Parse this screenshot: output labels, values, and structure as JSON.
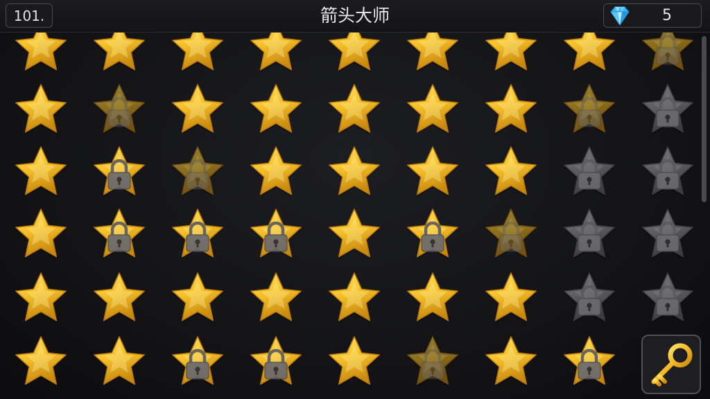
{
  "header": {
    "level_label": "101.",
    "title": "箭头大师",
    "gems": "5"
  },
  "icons": {
    "gem": "diamond-icon",
    "key": "key-icon",
    "lock": "padlock-icon",
    "star": "star-icon"
  },
  "colors": {
    "gold": "#F4C02A",
    "gold_light": "#FFE36A",
    "gold_dark": "#C98A10",
    "gray_star": "#5E5E62",
    "lock_gray": "#6A6A6E",
    "gem_blue": "#3FB8F5"
  },
  "grid": {
    "columns": 9,
    "rows": 6,
    "cells": [
      [
        "gold",
        "gold",
        "gold",
        "gold",
        "gold",
        "gold",
        "gold",
        "gold",
        "gold-locked-faded"
      ],
      [
        "gold",
        "gold-locked-faded",
        "gold",
        "gold",
        "gold",
        "gold",
        "gold",
        "gold-locked-faded",
        "gray-locked"
      ],
      [
        "gold",
        "gold-locked",
        "gold-locked-faded",
        "gold",
        "gold",
        "gold",
        "gold",
        "gray-locked",
        "gray-locked"
      ],
      [
        "gold",
        "gold-locked",
        "gold-locked",
        "gold-locked",
        "gold",
        "gold-locked",
        "gold-locked-faded",
        "gray-locked",
        "gray-locked"
      ],
      [
        "gold",
        "gold",
        "gold",
        "gold",
        "gold",
        "gold",
        "gold",
        "gray-locked",
        "gray-locked"
      ],
      [
        "gold",
        "gold",
        "gold-locked",
        "gold-locked",
        "gold",
        "gold-locked-faded",
        "gold",
        "gold-locked",
        ""
      ]
    ]
  }
}
